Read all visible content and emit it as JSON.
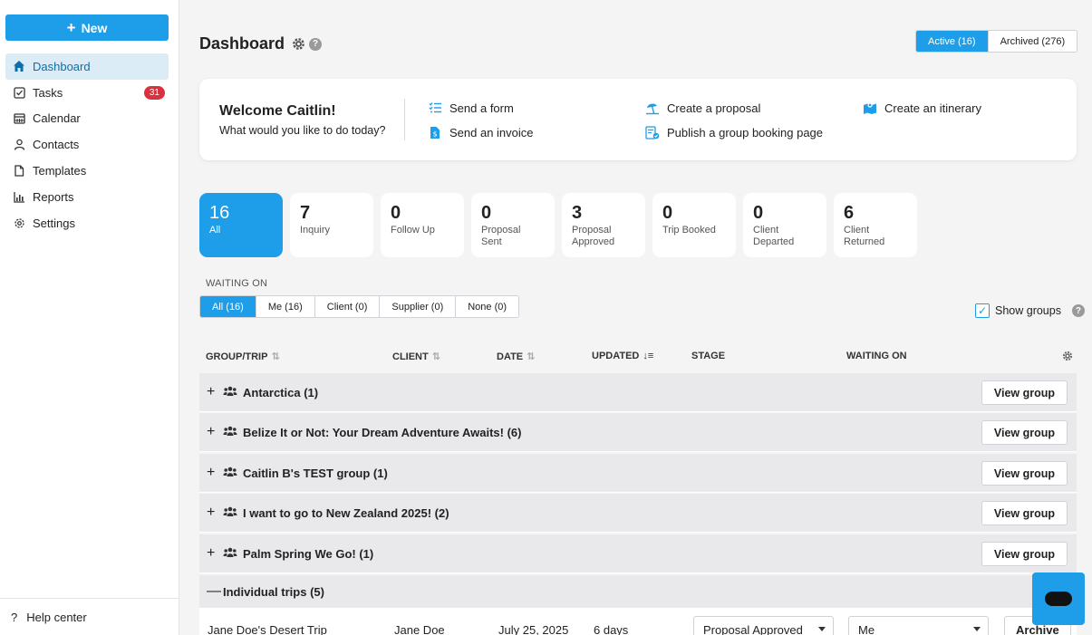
{
  "sidebar": {
    "new_label": "New",
    "items": [
      {
        "label": "Dashboard",
        "icon": "home-icon",
        "badge": ""
      },
      {
        "label": "Tasks",
        "icon": "checkbox-icon",
        "badge": "31"
      },
      {
        "label": "Calendar",
        "icon": "calendar-icon",
        "badge": ""
      },
      {
        "label": "Contacts",
        "icon": "user-icon",
        "badge": ""
      },
      {
        "label": "Templates",
        "icon": "document-icon",
        "badge": ""
      },
      {
        "label": "Reports",
        "icon": "chart-icon",
        "badge": ""
      },
      {
        "label": "Settings",
        "icon": "gear-icon",
        "badge": ""
      }
    ],
    "help_label": "Help center"
  },
  "header": {
    "title": "Dashboard",
    "active_tab": "Active (16)",
    "archived_tab": "Archived (276)"
  },
  "welcome": {
    "heading": "Welcome Caitlin!",
    "subheading": "What would you like to do today?",
    "actions": {
      "send_form": "Send a form",
      "send_invoice": "Send an invoice",
      "create_proposal": "Create a proposal",
      "publish_booking": "Publish a group booking page",
      "create_itinerary": "Create an itinerary"
    }
  },
  "stats": [
    {
      "count": "16",
      "label": "All"
    },
    {
      "count": "7",
      "label": "Inquiry"
    },
    {
      "count": "0",
      "label": "Follow Up"
    },
    {
      "count": "0",
      "label": "Proposal Sent"
    },
    {
      "count": "3",
      "label": "Proposal Approved"
    },
    {
      "count": "0",
      "label": "Trip Booked"
    },
    {
      "count": "0",
      "label": "Client Departed"
    },
    {
      "count": "6",
      "label": "Client Returned"
    }
  ],
  "waiting_on": {
    "label": "WAITING ON",
    "filters": [
      "All (16)",
      "Me (16)",
      "Client (0)",
      "Supplier (0)",
      "None (0)"
    ]
  },
  "show_groups_label": "Show groups",
  "table": {
    "headers": {
      "group_trip": "GROUP/TRIP",
      "client": "CLIENT",
      "date": "DATE",
      "updated": "UPDATED",
      "stage": "STAGE",
      "waiting_on": "WAITING ON"
    },
    "view_group_label": "View group",
    "groups": [
      "Antarctica (1)",
      "Belize It or Not: Your Dream Adventure Awaits! (6)",
      "Caitlin B's TEST group (1)",
      "I want to go to New Zealand 2025! (2)",
      "Palm Spring We Go! (1)"
    ],
    "individual_label": "Individual trips (5)",
    "first_trip": {
      "name": "Jane Doe's Desert Trip",
      "client": "Jane Doe",
      "date": "July 25, 2025",
      "updated": "6 days",
      "stage": "Proposal Approved",
      "waiting_on": "Me",
      "archive_label": "Archive"
    }
  },
  "colors": {
    "accent": "#1e9ee8",
    "badge": "#d9323f"
  }
}
